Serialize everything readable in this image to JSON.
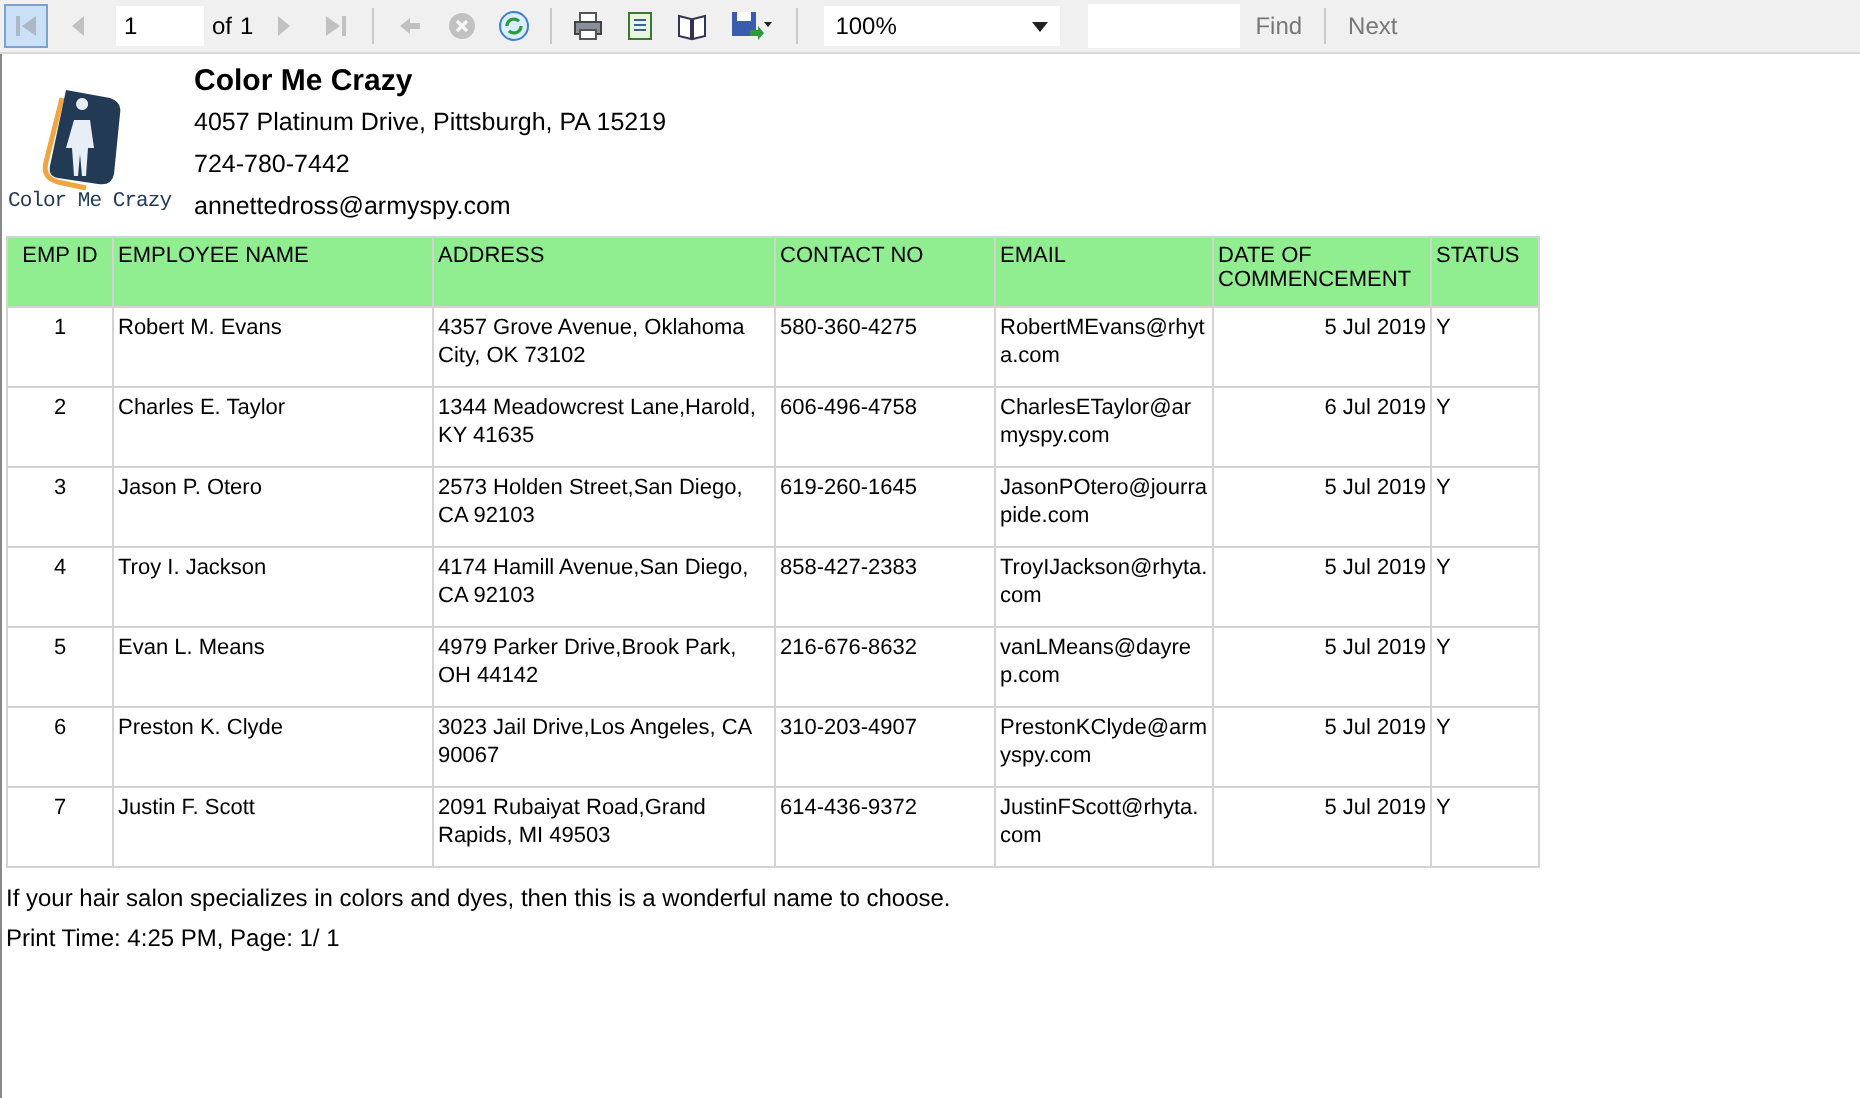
{
  "toolbar": {
    "first": {
      "disabled": true,
      "selected": true
    },
    "prev": {
      "disabled": true
    },
    "page": "1",
    "of_label": "of",
    "page_count": "1",
    "next": {
      "disabled": true
    },
    "last": {
      "disabled": true
    },
    "back": {
      "disabled": true
    },
    "stop": {
      "disabled": true
    },
    "zoom": "100%",
    "find": "Find",
    "next_match": "Next"
  },
  "company": {
    "name": "Color Me Crazy",
    "logo_text": "Color Me Crazy",
    "address": "4057 Platinum Drive, Pittsburgh, PA 15219",
    "phone": "724-780-7442",
    "email": "annettedross@armyspy.com"
  },
  "table": {
    "columns": [
      "EMP ID",
      "EMPLOYEE NAME",
      "ADDRESS",
      "CONTACT NO",
      "EMAIL",
      "DATE OF COMMENCEMENT",
      "STATUS"
    ],
    "rows": [
      [
        "1",
        "Robert M. Evans",
        "4357 Grove Avenue, Oklahoma City, OK 73102",
        "580-360-4275",
        "RobertMEvans@rhyta.com",
        "5 Jul 2019",
        "Y"
      ],
      [
        "2",
        "Charles E. Taylor",
        "1344 Meadowcrest Lane,Harold, KY 41635",
        "606-496-4758",
        "CharlesETaylor@armyspy.com",
        "6 Jul 2019",
        "Y"
      ],
      [
        "3",
        "Jason P. Otero",
        "2573 Holden Street,San Diego, CA 92103",
        "619-260-1645",
        "JasonPOtero@jourrapide.com",
        "5 Jul 2019",
        "Y"
      ],
      [
        "4",
        "Troy I. Jackson",
        "4174 Hamill Avenue,San Diego, CA 92103",
        "858-427-2383",
        "TroyIJackson@rhyta.com",
        "5 Jul 2019",
        "Y"
      ],
      [
        "5",
        "Evan L. Means",
        "4979 Parker Drive,Brook Park, OH 44142",
        "216-676-8632",
        "vanLMeans@dayrep.com",
        "5 Jul 2019",
        "Y"
      ],
      [
        "6",
        "Preston K. Clyde",
        "3023 Jail Drive,Los Angeles, CA 90067",
        "310-203-4907",
        "PrestonKClyde@armyspy.com",
        "5 Jul 2019",
        "Y"
      ],
      [
        "7",
        "Justin F. Scott",
        "2091 Rubaiyat Road,Grand Rapids, MI 49503",
        "614-436-9372",
        "JustinFScott@rhyta.com",
        "5 Jul 2019",
        "Y"
      ]
    ]
  },
  "footer_note": "If your hair salon specializes in colors and dyes, then this is a wonderful name to choose.",
  "print_time": "Print Time: 4:25 PM, Page: 1/ 1"
}
